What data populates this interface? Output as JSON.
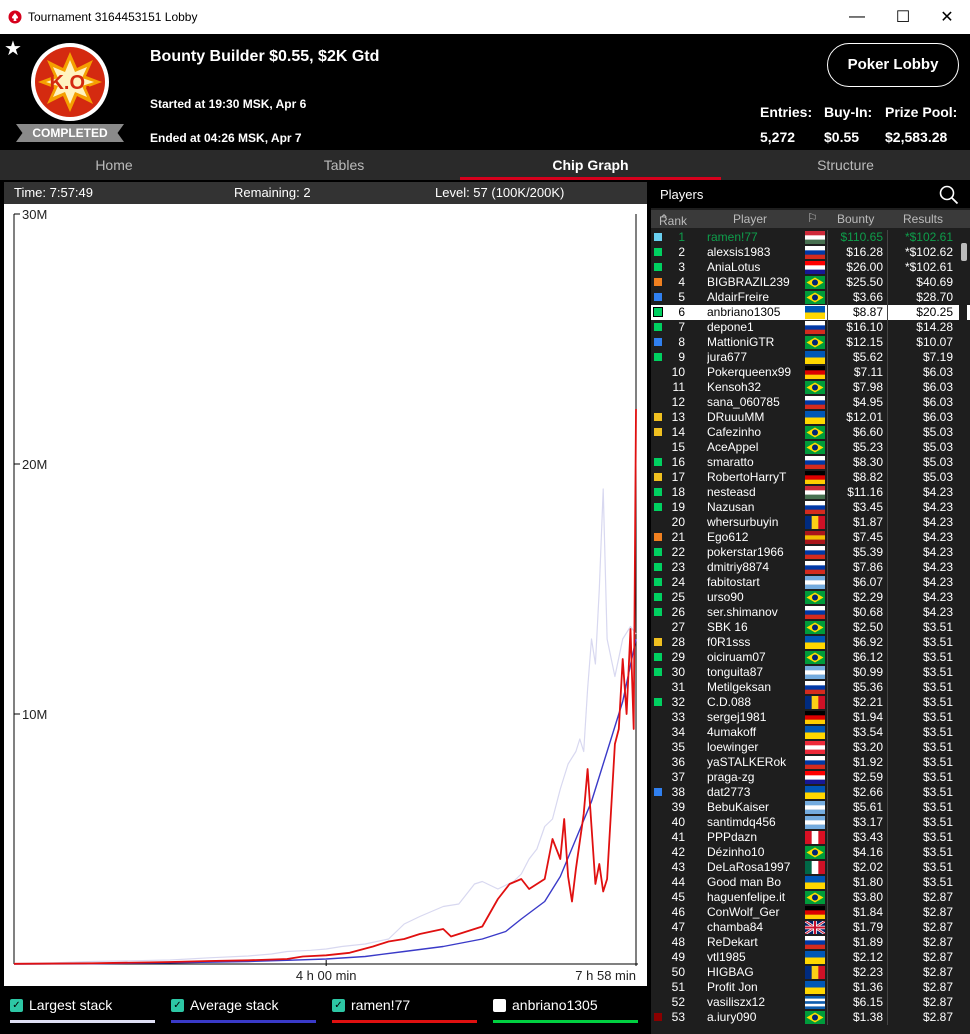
{
  "window": {
    "title": "Tournament 3164453151 Lobby",
    "minimize": "—",
    "maximize": "☐",
    "close": "✕"
  },
  "header": {
    "logo_text": "K.O.",
    "status": "COMPLETED",
    "tournament_name": "Bounty Builder $0.55, $2K Gtd",
    "started": "Started at 19:30 MSK, Apr 6",
    "ended": "Ended at 04:26 MSK, Apr 7",
    "lobby_button": "Poker Lobby",
    "entries_label": "Entries:",
    "entries_value": "5,272",
    "buyin_label": "Buy-In:",
    "buyin_value": "$0.55",
    "prize_label": "Prize Pool:",
    "prize_value": "$2,583.28"
  },
  "tabs": [
    "Home",
    "Tables",
    "Chip Graph",
    "Structure"
  ],
  "active_tab": "Chip Graph",
  "graph": {
    "time": "Time: 7:57:49",
    "remaining": "Remaining: 2",
    "level": "Level: 57 (100K/200K)",
    "y_ticks": [
      "30M",
      "20M",
      "10M"
    ],
    "x_ticks": [
      "4 h 00 min",
      "7 h 58 min"
    ]
  },
  "chart_data": {
    "type": "line",
    "xlabel": "",
    "ylabel": "",
    "x_unit": "hours",
    "xlim": [
      0,
      7.97
    ],
    "ylim": [
      0,
      30000000
    ],
    "x_ticks": [
      {
        "label": "4 h 00 min",
        "x": 4.0
      },
      {
        "label": "7 h 58 min",
        "x": 7.97
      }
    ],
    "y_ticks": [
      {
        "label": "30M",
        "y": 30000000
      },
      {
        "label": "20M",
        "y": 20000000
      },
      {
        "label": "10M",
        "y": 10000000
      }
    ],
    "series": [
      {
        "name": "Largest stack",
        "color": "#d8d8f0",
        "points": [
          [
            0,
            0.02
          ],
          [
            0.5,
            0.05
          ],
          [
            1,
            0.1
          ],
          [
            1.5,
            0.13
          ],
          [
            2,
            0.16
          ],
          [
            2.5,
            0.25
          ],
          [
            3,
            0.32
          ],
          [
            3.3,
            0.4
          ],
          [
            3.5,
            0.5
          ],
          [
            3.8,
            0.55
          ],
          [
            4,
            0.6
          ],
          [
            4.2,
            0.7
          ],
          [
            4.5,
            0.8
          ],
          [
            4.8,
            1.0
          ],
          [
            5,
            1.6
          ],
          [
            5.2,
            1.9
          ],
          [
            5.5,
            2.3
          ],
          [
            5.7,
            2.4
          ],
          [
            5.9,
            3.2
          ],
          [
            6,
            3.3
          ],
          [
            6.2,
            3.0
          ],
          [
            6.4,
            3.3
          ],
          [
            6.5,
            3.6
          ],
          [
            6.6,
            4.2
          ],
          [
            6.7,
            4.6
          ],
          [
            6.8,
            5.5
          ],
          [
            6.9,
            5.8
          ],
          [
            7,
            7.0
          ],
          [
            7.1,
            8.0
          ],
          [
            7.2,
            8.5
          ],
          [
            7.25,
            9.0
          ],
          [
            7.3,
            8.5
          ],
          [
            7.35,
            11.0
          ],
          [
            7.4,
            13.0
          ],
          [
            7.45,
            12.0
          ],
          [
            7.5,
            15.0
          ],
          [
            7.55,
            19.0
          ],
          [
            7.6,
            13.0
          ],
          [
            7.7,
            11.5
          ],
          [
            7.8,
            13.0
          ],
          [
            7.9,
            13.5
          ],
          [
            7.97,
            13.2
          ]
        ]
      },
      {
        "name": "Average stack",
        "color": "#3a3ac8",
        "points": [
          [
            0,
            0.0
          ],
          [
            1,
            0.01
          ],
          [
            2,
            0.05
          ],
          [
            3,
            0.1
          ],
          [
            3.5,
            0.15
          ],
          [
            4,
            0.2
          ],
          [
            4.5,
            0.3
          ],
          [
            5,
            0.5
          ],
          [
            5.5,
            0.7
          ],
          [
            6,
            1.0
          ],
          [
            6.3,
            1.3
          ],
          [
            6.5,
            1.8
          ],
          [
            6.8,
            2.5
          ],
          [
            7,
            3.5
          ],
          [
            7.2,
            5.0
          ],
          [
            7.4,
            6.5
          ],
          [
            7.6,
            8.5
          ],
          [
            7.8,
            10.5
          ],
          [
            7.97,
            13.0
          ]
        ]
      },
      {
        "name": "ramen!77",
        "color": "#e01010",
        "points": [
          [
            0,
            0.01
          ],
          [
            1,
            0.03
          ],
          [
            2,
            0.08
          ],
          [
            2.5,
            0.12
          ],
          [
            3,
            0.15
          ],
          [
            3.5,
            0.2
          ],
          [
            3.7,
            0.3
          ],
          [
            4,
            0.35
          ],
          [
            4.3,
            0.45
          ],
          [
            4.6,
            0.7
          ],
          [
            4.8,
            0.9
          ],
          [
            5,
            1.0
          ],
          [
            5.2,
            1.2
          ],
          [
            5.5,
            1.4
          ],
          [
            5.6,
            1.1
          ],
          [
            5.8,
            1.3
          ],
          [
            6,
            1.5
          ],
          [
            6.2,
            2.6
          ],
          [
            6.35,
            3.2
          ],
          [
            6.5,
            3.4
          ],
          [
            6.6,
            3.0
          ],
          [
            6.8,
            3.4
          ],
          [
            6.9,
            5.0
          ],
          [
            7.0,
            4.2
          ],
          [
            7.05,
            5.8
          ],
          [
            7.1,
            3.5
          ],
          [
            7.15,
            2.5
          ],
          [
            7.2,
            3.8
          ],
          [
            7.3,
            6.0
          ],
          [
            7.35,
            7.8
          ],
          [
            7.4,
            5.5
          ],
          [
            7.45,
            3.2
          ],
          [
            7.5,
            4.0
          ],
          [
            7.55,
            2.9
          ],
          [
            7.6,
            3.4
          ],
          [
            7.7,
            8.8
          ],
          [
            7.75,
            9.4
          ],
          [
            7.8,
            12.2
          ],
          [
            7.85,
            10.0
          ],
          [
            7.9,
            13.4
          ],
          [
            7.94,
            9.4
          ],
          [
            7.97,
            22.2
          ]
        ]
      }
    ]
  },
  "legend": [
    {
      "label": "Largest stack",
      "checked": true,
      "color": "#e0e0f4"
    },
    {
      "label": "Average stack",
      "checked": true,
      "color": "#3a3ac8"
    },
    {
      "label": "ramen!77",
      "checked": true,
      "color": "#e01010"
    },
    {
      "label": "anbriano1305",
      "checked": false,
      "color": "#00d040"
    }
  ],
  "players_panel": {
    "title": "Players",
    "columns": [
      "Rank",
      "Player",
      "Bounty",
      "Results"
    ],
    "rows": [
      {
        "rank": "1",
        "name": "ramen!77",
        "bounty": "$110.65",
        "result": "*$102.61",
        "mark": "#6ad0f0",
        "flag": "hu"
      },
      {
        "rank": "2",
        "name": "alexsis1983",
        "bounty": "$16.28",
        "result": "*$102.62",
        "mark": "#00d060",
        "flag": "ru"
      },
      {
        "rank": "3",
        "name": "AniaLotus",
        "bounty": "$26.00",
        "result": "*$102.61",
        "mark": "#00d060",
        "flag": "hr"
      },
      {
        "rank": "4",
        "name": "BIGBRAZIL239",
        "bounty": "$25.50",
        "result": "$40.69",
        "mark": "#f08020",
        "flag": "br"
      },
      {
        "rank": "5",
        "name": "AldairFreire",
        "bounty": "$3.66",
        "result": "$28.70",
        "mark": "#3080f0",
        "flag": "br"
      },
      {
        "rank": "6",
        "name": "anbriano1305",
        "bounty": "$8.87",
        "result": "$20.25",
        "mark": "#00d060",
        "flag": "ua"
      },
      {
        "rank": "7",
        "name": "depone1",
        "bounty": "$16.10",
        "result": "$14.28",
        "mark": "#00d060",
        "flag": "ru"
      },
      {
        "rank": "8",
        "name": "MattioniGTR",
        "bounty": "$12.15",
        "result": "$10.07",
        "mark": "#3080f0",
        "flag": "br"
      },
      {
        "rank": "9",
        "name": "jura677",
        "bounty": "$5.62",
        "result": "$7.19",
        "mark": "#00d060",
        "flag": "ua"
      },
      {
        "rank": "10",
        "name": "Pokerqueenx99",
        "bounty": "$7.11",
        "result": "$6.03",
        "mark": "",
        "flag": "de"
      },
      {
        "rank": "11",
        "name": "Kensoh32",
        "bounty": "$7.98",
        "result": "$6.03",
        "mark": "",
        "flag": "br"
      },
      {
        "rank": "12",
        "name": "sana_060785",
        "bounty": "$4.95",
        "result": "$6.03",
        "mark": "",
        "flag": "ru"
      },
      {
        "rank": "13",
        "name": "DRuuuMM",
        "bounty": "$12.01",
        "result": "$6.03",
        "mark": "#f0c020",
        "flag": "ua"
      },
      {
        "rank": "14",
        "name": "Cafezinho",
        "bounty": "$6.60",
        "result": "$5.03",
        "mark": "#f0c020",
        "flag": "br"
      },
      {
        "rank": "15",
        "name": "AceAppel",
        "bounty": "$5.23",
        "result": "$5.03",
        "mark": "",
        "flag": "br"
      },
      {
        "rank": "16",
        "name": "smaratto",
        "bounty": "$8.30",
        "result": "$5.03",
        "mark": "#00d060",
        "flag": "ru"
      },
      {
        "rank": "17",
        "name": "RobertoHarryT",
        "bounty": "$8.82",
        "result": "$5.03",
        "mark": "#f0c020",
        "flag": "de"
      },
      {
        "rank": "18",
        "name": "nesteasd",
        "bounty": "$11.16",
        "result": "$4.23",
        "mark": "#00d060",
        "flag": "hu"
      },
      {
        "rank": "19",
        "name": "Nazusan",
        "bounty": "$3.45",
        "result": "$4.23",
        "mark": "#00d060",
        "flag": "ru"
      },
      {
        "rank": "20",
        "name": "whersurbuyin",
        "bounty": "$1.87",
        "result": "$4.23",
        "mark": "",
        "flag": "ro"
      },
      {
        "rank": "21",
        "name": "Ego612",
        "bounty": "$7.45",
        "result": "$4.23",
        "mark": "#f08020",
        "flag": "es"
      },
      {
        "rank": "22",
        "name": "pokerstar1966",
        "bounty": "$5.39",
        "result": "$4.23",
        "mark": "#00d060",
        "flag": "ru"
      },
      {
        "rank": "23",
        "name": "dmitriy8874",
        "bounty": "$7.86",
        "result": "$4.23",
        "mark": "#00d060",
        "flag": "ru"
      },
      {
        "rank": "24",
        "name": "fabitostart",
        "bounty": "$6.07",
        "result": "$4.23",
        "mark": "#00d060",
        "flag": "ar"
      },
      {
        "rank": "25",
        "name": "urso90",
        "bounty": "$2.29",
        "result": "$4.23",
        "mark": "#00d060",
        "flag": "br"
      },
      {
        "rank": "26",
        "name": "ser.shimanov",
        "bounty": "$0.68",
        "result": "$4.23",
        "mark": "#00d060",
        "flag": "ru"
      },
      {
        "rank": "27",
        "name": "SBK 16",
        "bounty": "$2.50",
        "result": "$3.51",
        "mark": "",
        "flag": "br"
      },
      {
        "rank": "28",
        "name": "f0R1sss",
        "bounty": "$6.92",
        "result": "$3.51",
        "mark": "#f0c020",
        "flag": "ua"
      },
      {
        "rank": "29",
        "name": "oiciruam07",
        "bounty": "$6.12",
        "result": "$3.51",
        "mark": "#00d060",
        "flag": "br"
      },
      {
        "rank": "30",
        "name": "tonguita87",
        "bounty": "$0.99",
        "result": "$3.51",
        "mark": "#00d060",
        "flag": "ar"
      },
      {
        "rank": "31",
        "name": "Metilgeksan",
        "bounty": "$5.36",
        "result": "$3.51",
        "mark": "",
        "flag": "ru"
      },
      {
        "rank": "32",
        "name": "C.D.088",
        "bounty": "$2.21",
        "result": "$3.51",
        "mark": "#00d060",
        "flag": "ro"
      },
      {
        "rank": "33",
        "name": "sergej1981",
        "bounty": "$1.94",
        "result": "$3.51",
        "mark": "",
        "flag": "de"
      },
      {
        "rank": "34",
        "name": "4umakoff",
        "bounty": "$3.54",
        "result": "$3.51",
        "mark": "",
        "flag": "ua"
      },
      {
        "rank": "35",
        "name": "loewinger",
        "bounty": "$3.20",
        "result": "$3.51",
        "mark": "",
        "flag": "at"
      },
      {
        "rank": "36",
        "name": "yaSTALKERok",
        "bounty": "$1.92",
        "result": "$3.51",
        "mark": "",
        "flag": "ru"
      },
      {
        "rank": "37",
        "name": "praga-zg",
        "bounty": "$2.59",
        "result": "$3.51",
        "mark": "",
        "flag": "hr"
      },
      {
        "rank": "38",
        "name": "dat2773",
        "bounty": "$2.66",
        "result": "$3.51",
        "mark": "#3080f0",
        "flag": "ua"
      },
      {
        "rank": "39",
        "name": "BebuKaiser",
        "bounty": "$5.61",
        "result": "$3.51",
        "mark": "",
        "flag": "ar"
      },
      {
        "rank": "40",
        "name": "santimdq456",
        "bounty": "$3.17",
        "result": "$3.51",
        "mark": "",
        "flag": "ar"
      },
      {
        "rank": "41",
        "name": "PPPdazn",
        "bounty": "$3.43",
        "result": "$3.51",
        "mark": "",
        "flag": "pe"
      },
      {
        "rank": "42",
        "name": "Dézinho10",
        "bounty": "$4.16",
        "result": "$3.51",
        "mark": "",
        "flag": "br"
      },
      {
        "rank": "43",
        "name": "DeLaRosa1997",
        "bounty": "$2.02",
        "result": "$3.51",
        "mark": "",
        "flag": "mx"
      },
      {
        "rank": "44",
        "name": "Good man Bo",
        "bounty": "$1.80",
        "result": "$3.51",
        "mark": "",
        "flag": "ua"
      },
      {
        "rank": "45",
        "name": "haguenfelipe.it",
        "bounty": "$3.80",
        "result": "$2.87",
        "mark": "",
        "flag": "br"
      },
      {
        "rank": "46",
        "name": "ConWolf_Ger",
        "bounty": "$1.84",
        "result": "$2.87",
        "mark": "",
        "flag": "de"
      },
      {
        "rank": "47",
        "name": "chamba84",
        "bounty": "$1.79",
        "result": "$2.87",
        "mark": "",
        "flag": "gb"
      },
      {
        "rank": "48",
        "name": "ReDekart",
        "bounty": "$1.89",
        "result": "$2.87",
        "mark": "",
        "flag": "ru"
      },
      {
        "rank": "49",
        "name": "vtl1985",
        "bounty": "$2.12",
        "result": "$2.87",
        "mark": "",
        "flag": "ua"
      },
      {
        "rank": "50",
        "name": "HIGBAG",
        "bounty": "$2.23",
        "result": "$2.87",
        "mark": "",
        "flag": "ro"
      },
      {
        "rank": "51",
        "name": "Profit Jon",
        "bounty": "$1.36",
        "result": "$2.87",
        "mark": "",
        "flag": "ua"
      },
      {
        "rank": "52",
        "name": "vasiliszx12",
        "bounty": "$6.15",
        "result": "$2.87",
        "mark": "",
        "flag": "gr"
      },
      {
        "rank": "53",
        "name": "a.iury090",
        "bounty": "$1.38",
        "result": "$2.87",
        "mark": "#8b0000",
        "flag": "br"
      }
    ]
  },
  "colors": {
    "brand_red": "#d6001c",
    "panel_bg": "#1e1e1e"
  }
}
